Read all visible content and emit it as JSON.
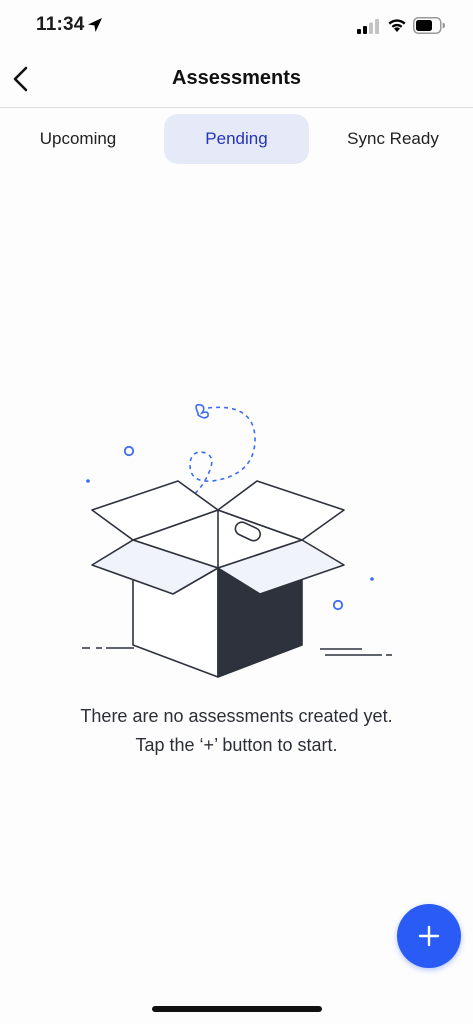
{
  "status_bar": {
    "time": "11:34"
  },
  "header": {
    "title": "Assessments",
    "back_icon": "chevron-left-icon"
  },
  "tabs": [
    {
      "label": "Upcoming",
      "active": false
    },
    {
      "label": "Pending",
      "active": true
    },
    {
      "label": "Sync Ready",
      "active": false
    }
  ],
  "empty_state": {
    "line1": "There are no assessments created yet.",
    "line2": "Tap the ‘+’ button to start.",
    "illustration": "open-box-icon"
  },
  "fab": {
    "icon": "plus-icon",
    "color": "#2a5cf5"
  },
  "colors": {
    "accent": "#2a5cf5",
    "active_tab_bg": "#e6e9f8",
    "active_tab_text": "#2335b4",
    "illustration_dark": "#2d323d"
  }
}
